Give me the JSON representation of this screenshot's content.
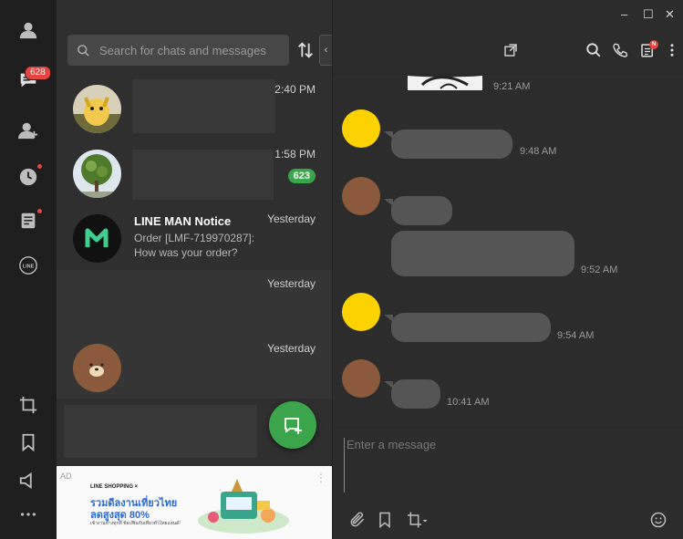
{
  "app": {
    "title": "LINE"
  },
  "rail": {
    "unread_badge": "628"
  },
  "search": {
    "placeholder": "Search for chats and messages"
  },
  "chats": [
    {
      "time": "2:40 PM"
    },
    {
      "time": "1:58 PM",
      "unread": "623"
    },
    {
      "name": "LINE MAN Notice",
      "preview": "Order [LMF-719970287]: How was your order?",
      "time": "Yesterday"
    },
    {
      "time": "Yesterday"
    },
    {
      "time": "Yesterday"
    }
  ],
  "ad": {
    "tag": "AD",
    "brand": "LINE SHOPPING ×",
    "line1": "รวมดีลงานเที่ยวไทย",
    "line2": "ลดสูงสุด 80%",
    "line3": "เข้างานห้างทุกที่ ช้อปฟินกับเที่ยวทั่วไทยแลนด์!"
  },
  "window": {
    "minimize": "–",
    "maximize": "☐",
    "close": "✕"
  },
  "header": {
    "notes_badge": "N"
  },
  "messages": [
    {
      "time": "9:21 AM"
    },
    {
      "time": "9:48 AM"
    },
    {
      "time": "9:52 AM"
    },
    {
      "time": "9:54 AM"
    },
    {
      "time": "10:41 AM"
    }
  ],
  "composer": {
    "placeholder": "Enter a message"
  },
  "colors": {
    "accent_green": "#3aa54a",
    "badge_red": "#e5453f",
    "bubble": "#555555"
  }
}
